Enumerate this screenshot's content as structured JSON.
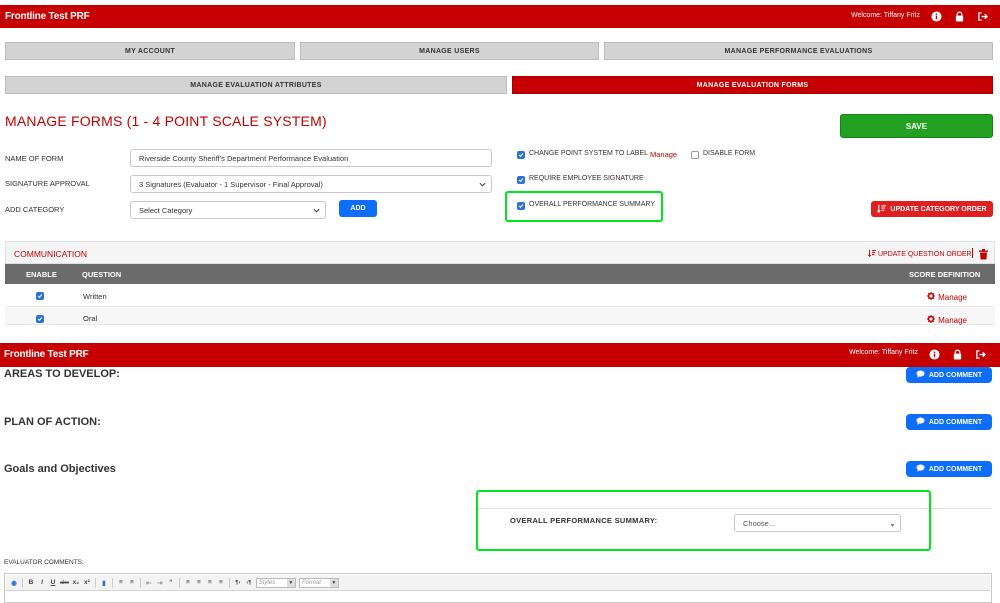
{
  "app": {
    "title": "Frontline Test PRF",
    "welcome": "Welcome: Tiffany Fritz"
  },
  "nav": {
    "row1": [
      "MY ACCOUNT",
      "MANAGE USERS",
      "MANAGE PERFORMANCE EVALUATIONS"
    ],
    "row2": [
      "MANAGE EVALUATION ATTRIBUTES",
      "MANAGE EVALUATION FORMS"
    ],
    "active": "MANAGE EVALUATION FORMS"
  },
  "form": {
    "page_title": "MANAGE FORMS (1 - 4 POINT SCALE SYSTEM)",
    "save_label": "SAVE",
    "name_label": "NAME OF FORM",
    "name_value": "Riverside County Sheriff's Department Performance Evaluation",
    "signature_label": "SIGNATURE APPROVAL",
    "signature_value": "3 Signatures (Evaluator - 1 Supervisor - Final Approval)",
    "category_label": "ADD CATEGORY",
    "category_value": "Select Category",
    "add_label": "ADD",
    "options": {
      "change_point": "CHANGE POINT SYSTEM TO LABEL",
      "manage_link": "Manage",
      "disable_form": "DISABLE FORM",
      "require_signature": "REQUIRE EMPLOYEE SIGNATURE",
      "overall_summary": "OVERALL PERFORMANCE SUMMARY"
    },
    "update_category_order": "UPDATE CATEGORY ORDER"
  },
  "category": {
    "name": "COMMUNICATION",
    "update_question_order": "UPDATE QUESTION ORDER",
    "columns": [
      "ENABLE",
      "QUESTION",
      "SCORE DEFINITION"
    ],
    "rows": [
      {
        "question": "Written",
        "action": "Manage"
      },
      {
        "question": "Oral",
        "action": "Manage"
      }
    ]
  },
  "evaluation": {
    "sections": [
      {
        "title": "AREAS TO DEVELOP:",
        "button": "ADD COMMENT"
      },
      {
        "title": "PLAN OF ACTION:",
        "button": "ADD COMMENT"
      },
      {
        "title": "Goals and Objectives",
        "button": "ADD COMMENT"
      }
    ],
    "summary_label": "OVERALL PERFORMANCE SUMMARY:",
    "summary_placeholder": "Choose...",
    "comments_label": "EVALUATOR COMMENTS:",
    "toolbar": {
      "styles": "Styles",
      "format": "Format"
    }
  },
  "colors": {
    "brand": "#c60000",
    "primary": "#0d6efd",
    "save": "#22a022",
    "highlight": "#00e61a"
  }
}
